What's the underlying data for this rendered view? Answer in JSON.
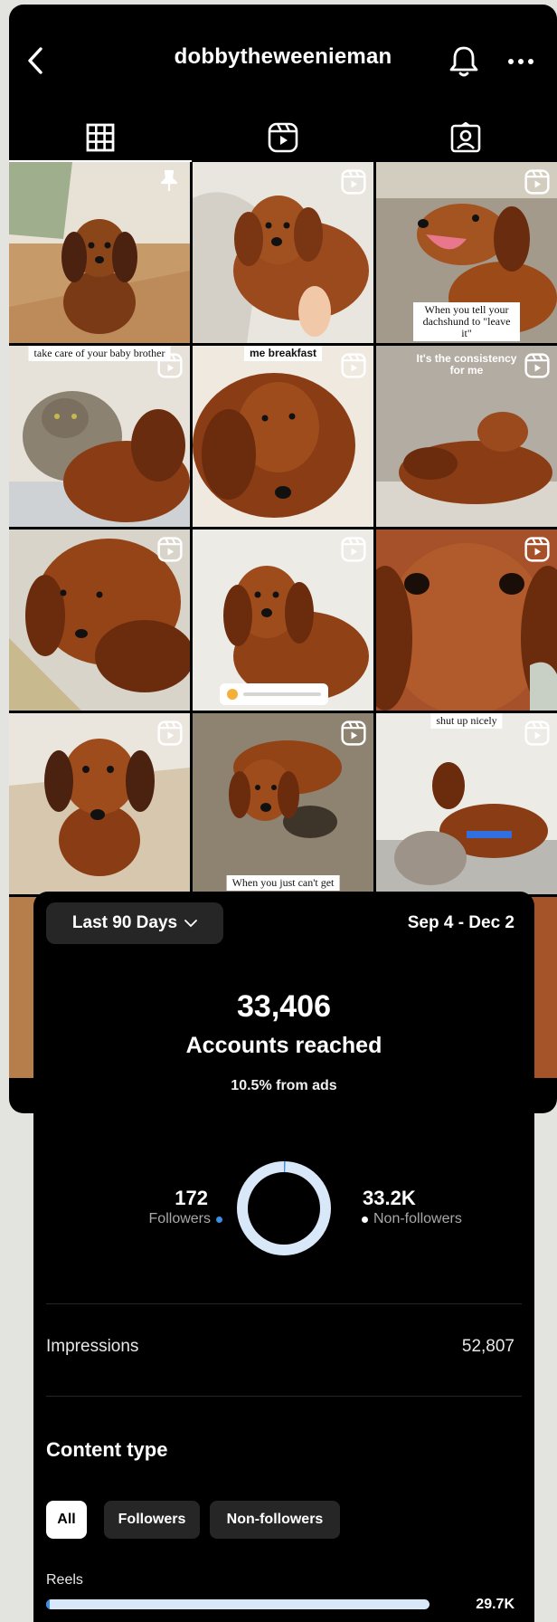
{
  "profile": {
    "username": "dobbytheweenieman"
  },
  "tabs": [
    {
      "name": "posts-grid-tab",
      "icon": "grid-icon",
      "active": true
    },
    {
      "name": "reels-tab",
      "icon": "reels-icon",
      "active": false
    },
    {
      "name": "tagged-tab",
      "icon": "tagged-icon",
      "active": false
    }
  ],
  "grid": {
    "captions": {
      "c3": "When you tell your dachshund to \"leave it\"",
      "c4": "take care of your baby brother",
      "c5": "me breakfast",
      "c6": "It's the consistency for me",
      "c10": "shut up nicely",
      "c11": "When you just can't get"
    }
  },
  "insights": {
    "range_label": "Last 90 Days",
    "date_range": "Sep 4 - Dec 2",
    "accounts_reached_value": "33,406",
    "accounts_reached_label": "Accounts reached",
    "ads_note": "10.5% from ads",
    "followers_value": "172",
    "followers_label": "Followers",
    "non_followers_value": "33.2K",
    "non_followers_label": "Non-followers",
    "followers_fraction": 0.005,
    "impressions_label": "Impressions",
    "impressions_value": "52,807",
    "content_type_title": "Content type",
    "filters": [
      "All",
      "Followers",
      "Non-followers"
    ],
    "reels_label": "Reels",
    "reels_value": "29.7K",
    "reels_followers_fraction": 0.01
  },
  "colors": {
    "followers": "#3a8ee6",
    "non_followers": "#d9e8f8",
    "background": "#000000"
  }
}
